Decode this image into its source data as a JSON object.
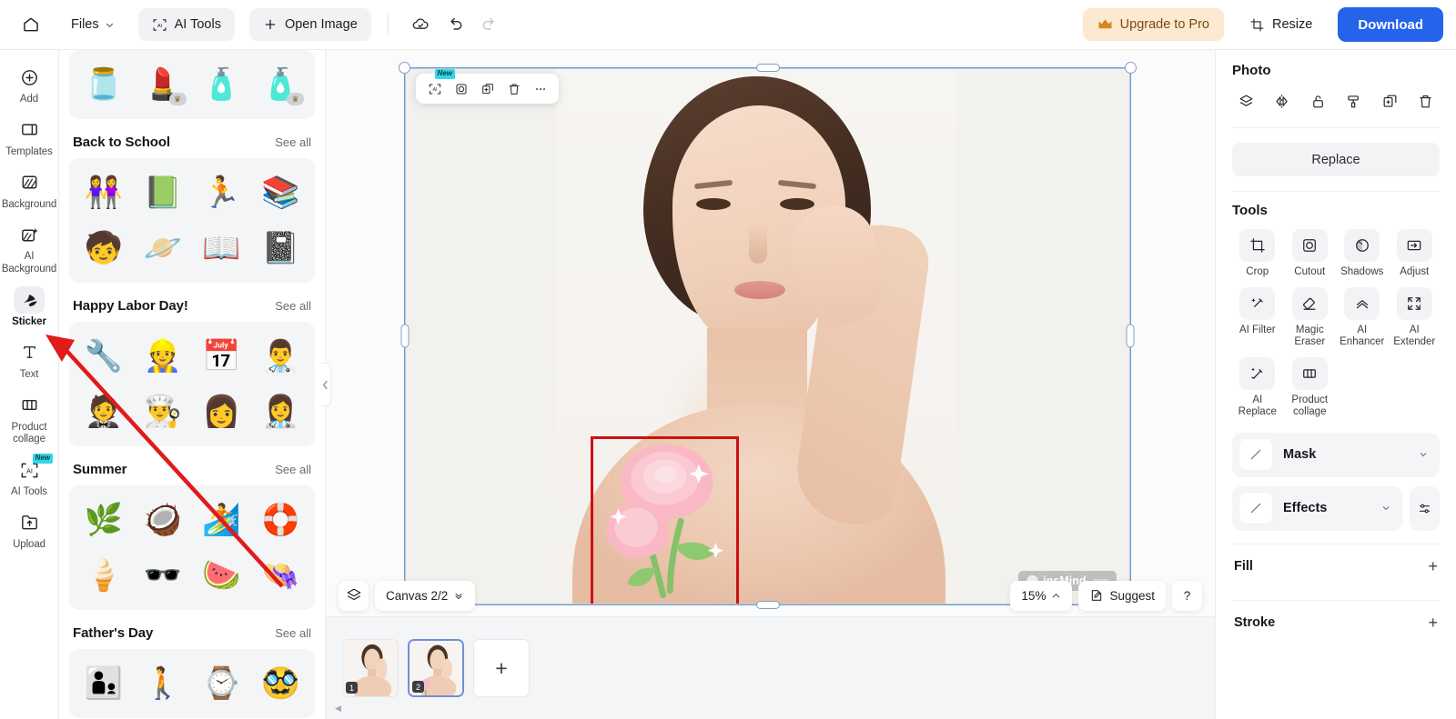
{
  "topbar": {
    "home_icon": "home-icon",
    "files_label": "Files",
    "files_chevron": "chevron-down-icon",
    "ai_tools_label": "AI Tools",
    "ai_tools_icon": "ai-scan-icon",
    "open_image_label": "Open Image",
    "open_image_icon": "plus-icon",
    "saved_icon": "cloud-check-icon",
    "undo_icon": "undo-icon",
    "redo_icon": "redo-icon",
    "upgrade_label": "Upgrade to Pro",
    "upgrade_icon": "crown-icon",
    "upgrade_bg": "#fcead0",
    "upgrade_color": "#7a4a12",
    "resize_label": "Resize",
    "resize_icon": "resize-icon",
    "download_label": "Download",
    "download_color": "#2563eb"
  },
  "rail": {
    "items": [
      {
        "label": "Add",
        "icon": "plus-circle-icon",
        "active": false,
        "badge": ""
      },
      {
        "label": "Templates",
        "icon": "templates-icon",
        "active": false,
        "badge": ""
      },
      {
        "label": "Background",
        "icon": "background-icon",
        "active": false,
        "badge": ""
      },
      {
        "label": "AI Background",
        "icon": "ai-background-icon",
        "active": false,
        "badge": ""
      },
      {
        "label": "Sticker",
        "icon": "sticker-icon",
        "active": true,
        "badge": ""
      },
      {
        "label": "Text",
        "icon": "text-icon",
        "active": false,
        "badge": ""
      },
      {
        "label": "Product collage",
        "icon": "product-collage-icon",
        "active": false,
        "badge": ""
      },
      {
        "label": "AI Tools",
        "icon": "ai-scan-icon",
        "active": false,
        "badge": "New"
      },
      {
        "label": "Upload",
        "icon": "upload-icon",
        "active": false,
        "badge": ""
      }
    ]
  },
  "panel": {
    "see_all_label": "See all",
    "collapse_icon": "chevron-left-icon",
    "categories": [
      {
        "title": "",
        "partial": true,
        "stickers": [
          {
            "glyph": "🫙",
            "pro": false
          },
          {
            "glyph": "💄",
            "pro": true
          },
          {
            "glyph": "🧴",
            "pro": false
          },
          {
            "glyph": "🧴",
            "pro": true
          }
        ]
      },
      {
        "title": "Back to School",
        "partial": false,
        "stickers": [
          {
            "glyph": "👭",
            "pro": false
          },
          {
            "glyph": "📗",
            "pro": false
          },
          {
            "glyph": "🏃",
            "pro": false
          },
          {
            "glyph": "📚",
            "pro": false
          },
          {
            "glyph": "🧒",
            "pro": false
          },
          {
            "glyph": "🪐",
            "pro": false
          },
          {
            "glyph": "📖",
            "pro": false
          },
          {
            "glyph": "📓",
            "pro": false
          }
        ]
      },
      {
        "title": "Happy Labor Day!",
        "partial": false,
        "stickers": [
          {
            "glyph": "🔧",
            "pro": false
          },
          {
            "glyph": "👷",
            "pro": false
          },
          {
            "glyph": "📅",
            "pro": false
          },
          {
            "glyph": "👨‍⚕️",
            "pro": false
          },
          {
            "glyph": "🤵",
            "pro": false
          },
          {
            "glyph": "👨‍🍳",
            "pro": false
          },
          {
            "glyph": "👩",
            "pro": false
          },
          {
            "glyph": "👩‍⚕️",
            "pro": false
          }
        ]
      },
      {
        "title": "Summer",
        "partial": false,
        "stickers": [
          {
            "glyph": "🌿",
            "pro": false
          },
          {
            "glyph": "🥥",
            "pro": false
          },
          {
            "glyph": "🏄",
            "pro": false
          },
          {
            "glyph": "🛟",
            "pro": false
          },
          {
            "glyph": "🍦",
            "pro": false
          },
          {
            "glyph": "🕶️",
            "pro": false
          },
          {
            "glyph": "🍉",
            "pro": false
          },
          {
            "glyph": "👒",
            "pro": false
          }
        ]
      },
      {
        "title": "Father's Day",
        "partial": false,
        "stickers": [
          {
            "glyph": "👨‍👦",
            "pro": false
          },
          {
            "glyph": "🚶",
            "pro": false
          },
          {
            "glyph": "⌚",
            "pro": false
          },
          {
            "glyph": "🥸",
            "pro": false
          }
        ]
      }
    ]
  },
  "canvas": {
    "float_toolbar": [
      {
        "icon": "ai-scan-icon",
        "badge": "New"
      },
      {
        "icon": "cutout-icon",
        "badge": ""
      },
      {
        "icon": "duplicate-icon",
        "badge": ""
      },
      {
        "icon": "trash-icon",
        "badge": ""
      },
      {
        "icon": "more-icon",
        "badge": ""
      }
    ],
    "watermark": "insMind",
    "watermark_suffix": ".com",
    "rotate_icon": "rotate-icon",
    "selection_color": "#6b9ad4",
    "highlight_color": "#cc1111"
  },
  "bottom": {
    "layers_icon": "layers-icon",
    "canvas_label": "Canvas 2/2",
    "canvas_chevron": "chevron-expand-icon",
    "zoom_label": "15%",
    "zoom_chevron": "chevron-up-icon",
    "suggest_label": "Suggest",
    "suggest_icon": "suggest-icon",
    "help_label": "?"
  },
  "pages": {
    "thumbs": [
      {
        "number": "1",
        "active": false
      },
      {
        "number": "2",
        "active": true
      }
    ],
    "add_label": "+",
    "scroll_icon": "chevron-left-icon"
  },
  "right": {
    "title": "Photo",
    "actions": [
      {
        "icon": "layers-icon"
      },
      {
        "icon": "flip-icon"
      },
      {
        "icon": "unlock-icon"
      },
      {
        "icon": "paint-roller-icon"
      },
      {
        "icon": "duplicate-icon"
      },
      {
        "icon": "trash-icon"
      }
    ],
    "replace_label": "Replace",
    "tools_title": "Tools",
    "tools": [
      {
        "label": "Crop",
        "icon": "crop-icon"
      },
      {
        "label": "Cutout",
        "icon": "cutout-icon"
      },
      {
        "label": "Shadows",
        "icon": "shadows-icon"
      },
      {
        "label": "Adjust",
        "icon": "adjust-icon"
      },
      {
        "label": "AI Filter",
        "icon": "ai-filter-icon"
      },
      {
        "label": "Magic Eraser",
        "icon": "eraser-icon"
      },
      {
        "label": "AI Enhancer",
        "icon": "enhancer-icon"
      },
      {
        "label": "AI Extender",
        "icon": "extender-icon"
      },
      {
        "label": "AI Replace",
        "icon": "ai-replace-icon"
      },
      {
        "label": "Product collage",
        "icon": "product-collage-icon"
      }
    ],
    "mask_label": "Mask",
    "effects_label": "Effects",
    "effects_settings_icon": "sliders-icon",
    "fill_label": "Fill",
    "stroke_label": "Stroke",
    "add_symbol": "+"
  }
}
